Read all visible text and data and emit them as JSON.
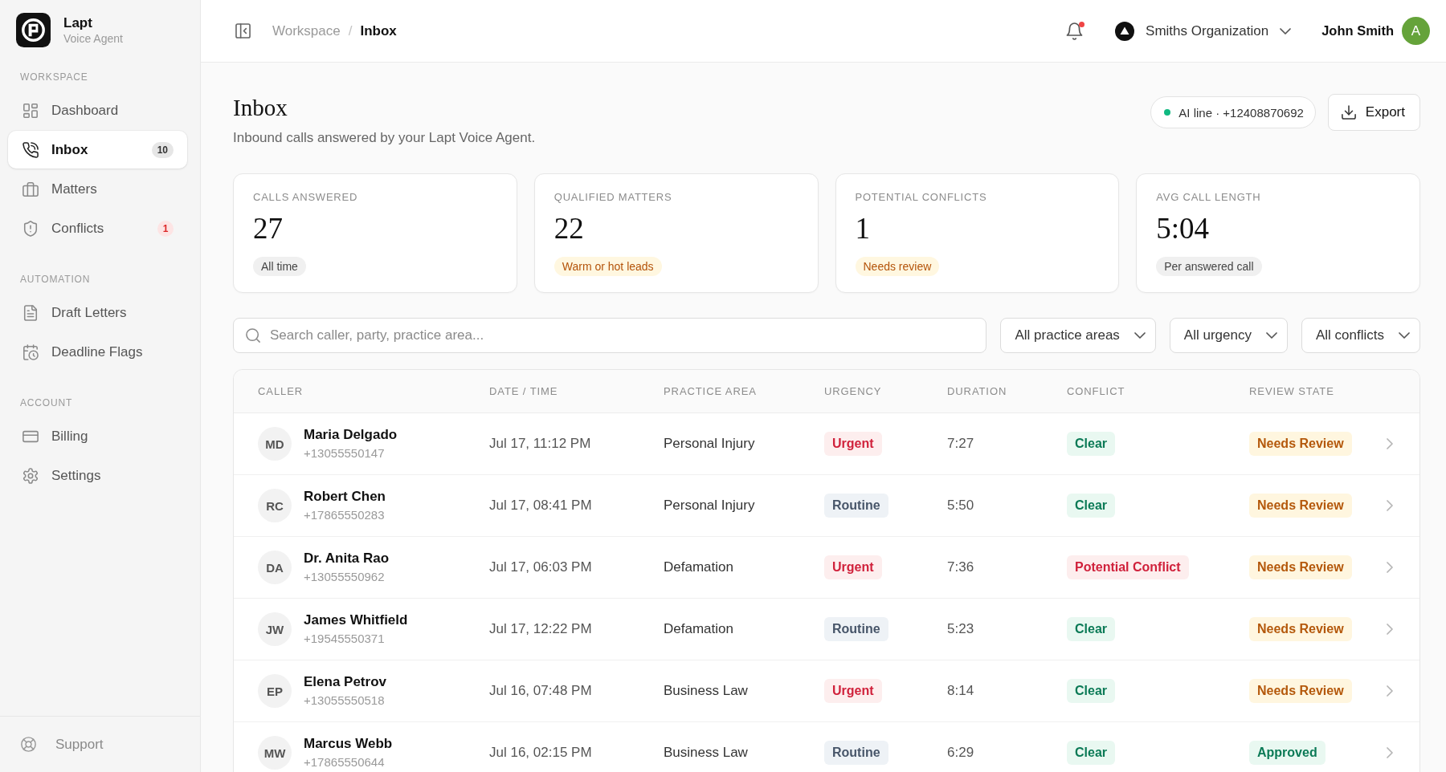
{
  "sidebar": {
    "brand": {
      "name": "Lapt",
      "tagline": "Voice Agent"
    },
    "sections": [
      {
        "heading": "WORKSPACE",
        "items": [
          {
            "label": "Dashboard",
            "selected": false
          },
          {
            "label": "Inbox",
            "selected": true,
            "badge": {
              "text": "10",
              "kind": "neutral"
            }
          },
          {
            "label": "Matters",
            "selected": false
          },
          {
            "label": "Conflicts",
            "selected": false,
            "badge": {
              "text": "1",
              "kind": "alert"
            }
          }
        ]
      },
      {
        "heading": "AUTOMATION",
        "items": [
          {
            "label": "Draft Letters",
            "selected": false
          },
          {
            "label": "Deadline Flags",
            "selected": false
          }
        ]
      },
      {
        "heading": "ACCOUNT",
        "items": [
          {
            "label": "Billing",
            "selected": false
          },
          {
            "label": "Settings",
            "selected": false
          }
        ]
      }
    ],
    "footer_link": "Support"
  },
  "topbar": {
    "breadcrumb": [
      {
        "label": "Workspace",
        "current": false
      },
      {
        "label": "Inbox",
        "current": true
      }
    ],
    "separator": "/",
    "unread_notifications": true,
    "organization": "Smiths Organization",
    "user": {
      "name": "John Smith",
      "initial": "A"
    }
  },
  "page": {
    "title": "Inbox",
    "subtitle": "Inbound calls answered by your Lapt Voice Agent.",
    "ai_line": {
      "text": "AI line · +12408870692",
      "online": true
    },
    "export_button": "Export"
  },
  "stats": [
    {
      "label": "CALLS ANSWERED",
      "value": "27",
      "note": "All time",
      "kind": "neutral"
    },
    {
      "label": "QUALIFIED MATTERS",
      "value": "22",
      "note": "Warm or hot leads",
      "kind": "warning"
    },
    {
      "label": "POTENTIAL CONFLICTS",
      "value": "1",
      "note": "Needs review",
      "kind": "warning"
    },
    {
      "label": "AVG CALL LENGTH",
      "value": "5:04",
      "note": "Per answered call",
      "kind": "neutral"
    }
  ],
  "filters": {
    "search_placeholder": "Search caller, party, practice area...",
    "dropdowns": [
      "All practice areas",
      "All urgency",
      "All conflicts"
    ]
  },
  "table": {
    "columns": [
      "CALLER",
      "DATE / TIME",
      "PRACTICE AREA",
      "URGENCY",
      "DURATION",
      "CONFLICT",
      "REVIEW STATE"
    ],
    "rows": [
      {
        "initials": "MD",
        "name": "Maria Delgado",
        "phone": "+13055550147",
        "datetime": "Jul 17, 11:12 PM",
        "practice_area": "Personal Injury",
        "urgency": {
          "text": "Urgent",
          "kind": "urgent"
        },
        "duration": "7:27",
        "conflict": {
          "text": "Clear",
          "kind": "clear"
        },
        "review": {
          "text": "Needs Review",
          "kind": "pending"
        }
      },
      {
        "initials": "RC",
        "name": "Robert Chen",
        "phone": "+17865550283",
        "datetime": "Jul 17, 08:41 PM",
        "practice_area": "Personal Injury",
        "urgency": {
          "text": "Routine",
          "kind": "routine"
        },
        "duration": "5:50",
        "conflict": {
          "text": "Clear",
          "kind": "clear"
        },
        "review": {
          "text": "Needs Review",
          "kind": "pending"
        }
      },
      {
        "initials": "DA",
        "name": "Dr. Anita Rao",
        "phone": "+13055550962",
        "datetime": "Jul 17, 06:03 PM",
        "practice_area": "Defamation",
        "urgency": {
          "text": "Urgent",
          "kind": "urgent"
        },
        "duration": "7:36",
        "conflict": {
          "text": "Potential Conflict",
          "kind": "potential"
        },
        "review": {
          "text": "Needs Review",
          "kind": "pending"
        }
      },
      {
        "initials": "JW",
        "name": "James Whitfield",
        "phone": "+19545550371",
        "datetime": "Jul 17, 12:22 PM",
        "practice_area": "Defamation",
        "urgency": {
          "text": "Routine",
          "kind": "routine"
        },
        "duration": "5:23",
        "conflict": {
          "text": "Clear",
          "kind": "clear"
        },
        "review": {
          "text": "Needs Review",
          "kind": "pending"
        }
      },
      {
        "initials": "EP",
        "name": "Elena Petrov",
        "phone": "+13055550518",
        "datetime": "Jul 16, 07:48 PM",
        "practice_area": "Business Law",
        "urgency": {
          "text": "Urgent",
          "kind": "urgent"
        },
        "duration": "8:14",
        "conflict": {
          "text": "Clear",
          "kind": "clear"
        },
        "review": {
          "text": "Needs Review",
          "kind": "pending"
        }
      },
      {
        "initials": "MW",
        "name": "Marcus Webb",
        "phone": "+17865550644",
        "datetime": "Jul 16, 02:15 PM",
        "practice_area": "Business Law",
        "urgency": {
          "text": "Routine",
          "kind": "routine"
        },
        "duration": "6:29",
        "conflict": {
          "text": "Clear",
          "kind": "clear"
        },
        "review": {
          "text": "Approved",
          "kind": "approved"
        }
      }
    ]
  }
}
